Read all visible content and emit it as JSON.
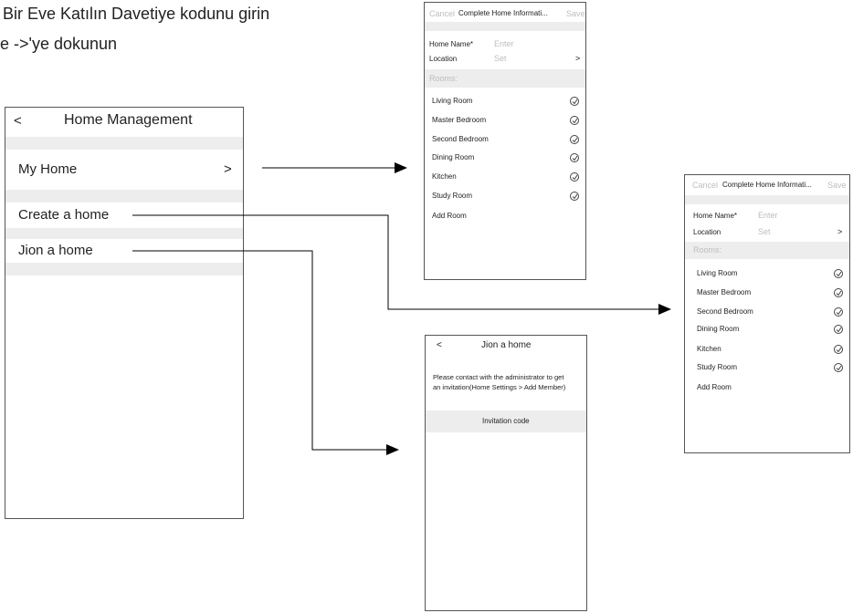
{
  "captions": {
    "line1": "Bir Eve Katılın Davetiye kodunu girin",
    "line2": "e ->'ye dokunun"
  },
  "home_management": {
    "back": "<",
    "title": "Home Management",
    "items": [
      {
        "label": "My Home",
        "chevron": ">"
      },
      {
        "label": "Create a home"
      },
      {
        "label": "Jion a home"
      }
    ]
  },
  "home_info": {
    "cancel": "Cancel",
    "title": "Complete Home Informati...",
    "save": "Save",
    "name_label": "Home Name*",
    "name_placeholder": "Enter",
    "location_label": "Location",
    "location_value": "Set",
    "location_chevron": ">",
    "rooms_header": "Rooms:",
    "rooms": [
      "Living Room",
      "Master Bedroom",
      "Second Bedroom",
      "Dining Room",
      "Kitchen",
      "Study Room"
    ],
    "add_room": "Add Room"
  },
  "join_home": {
    "back": "<",
    "title": "Jion a home",
    "message_line1": "Please contact with the administrator to get",
    "message_line2": "an invitation(Home Settings > Add Member)",
    "invitation_label": "Invitation code"
  },
  "icons": {
    "room_check": "check-circle-icon",
    "arrow": "arrow-right-icon"
  }
}
